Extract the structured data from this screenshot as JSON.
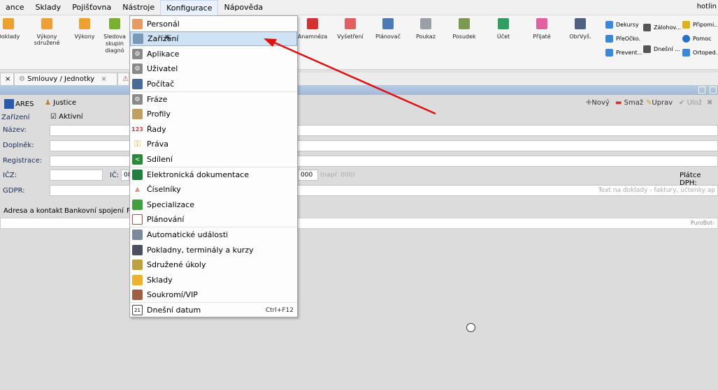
{
  "menubar": {
    "items": [
      "ance",
      "Sklady",
      "Pojišťovna",
      "Nástroje",
      "Konfigurace",
      "Nápověda"
    ],
    "hotline": "hotlin"
  },
  "ribbon": {
    "left": [
      {
        "label": "Doklady",
        "color": "#f0a030"
      },
      {
        "label": "Výkony\nsdružené",
        "color": "#f0a030"
      },
      {
        "label": "Výkony",
        "color": "#f0a030"
      },
      {
        "label": "Sledova\nskupin\ndiagnó",
        "color": "#78b030"
      }
    ],
    "right": [
      {
        "label": "Anamnéza",
        "color": "#d83030"
      },
      {
        "label": "Vyšetření",
        "color": "#e06060"
      },
      {
        "label": "Plánovač",
        "color": "#4a7ab8"
      },
      {
        "label": "Poukaz",
        "color": "#9aa0a8"
      },
      {
        "label": "Posudek",
        "color": "#7a9a50"
      },
      {
        "label": "Účet",
        "color": "#30a060"
      },
      {
        "label": "Přijaté",
        "color": "#e060a0"
      },
      {
        "label": "ObrVyš.",
        "color": "#506080"
      }
    ],
    "small": [
      {
        "label": "Dekursy",
        "color": "#3a88d8"
      },
      {
        "label": "PřeOčko.",
        "color": "#3a88d8"
      },
      {
        "label": "Prevent...",
        "color": "#3a88d8"
      },
      {
        "label": "Zálohov...",
        "color": "#555"
      },
      {
        "label": "Dnešní ...",
        "color": "#555"
      },
      {
        "label": "Připomi...",
        "color": "#e0b020"
      },
      {
        "label": "Pomoc",
        "color": "#2a70c8"
      },
      {
        "label": "Ortoped.",
        "color": "#3a88d8"
      }
    ]
  },
  "tabs": {
    "tab1": "Smlouvy / Jednotky"
  },
  "form": {
    "ares": "ARES",
    "justice": "Justice",
    "zarizeni": "Zařízení",
    "aktivni": "Aktivní",
    "nazev": "Název:",
    "doplnek": "Doplněk:",
    "registrace": "Registrace:",
    "icz": "IČZ:",
    "ic": "IČ:",
    "ic_value": "08",
    "dic_value": "000",
    "dic_hint": "(např. 000)",
    "platce": "Plátce DPH:",
    "gdpr": "GDPR:",
    "gdpr_hint": "Text na doklady - faktury, účtenky ap",
    "toolbar": {
      "novy": "Nový",
      "smaz": "Smaž",
      "uprav": "Uprav",
      "uloz": "Ulož"
    },
    "subtab1": "Adresa a kontakt",
    "subtab2": "Bankovní spojení",
    "subtab3": "F",
    "purobot": "PuroBot-"
  },
  "dropdown": {
    "items": [
      {
        "label": "Personál",
        "icon": "person-icon",
        "color": "#e89a60"
      },
      {
        "label": "Zařízení",
        "icon": "device-icon",
        "color": "#7a98b8"
      },
      {
        "label": "Aplikace",
        "icon": "gear-icon",
        "color": "#8a8a8a"
      },
      {
        "label": "Uživatel",
        "icon": "gear-icon",
        "color": "#8a8a8a"
      },
      {
        "label": "Počítač",
        "icon": "computer-icon",
        "color": "#4a6a9a"
      },
      {
        "label": "Fráze",
        "icon": "gear-icon",
        "color": "#8a8a8a"
      },
      {
        "label": "Profily",
        "icon": "profile-icon",
        "color": "#c0a060"
      },
      {
        "label": "Řady",
        "icon": "numbers-icon",
        "color": "#d04040"
      },
      {
        "label": "Práva",
        "icon": "key-icon",
        "color": "#e0b020"
      },
      {
        "label": "Sdílení",
        "icon": "share-icon",
        "color": "#2a8a3a"
      },
      {
        "label": "Elektronická dokumentace",
        "icon": "document-icon",
        "color": "#208040"
      },
      {
        "label": "Číselníky",
        "icon": "codelist-icon",
        "color": "#d04030"
      },
      {
        "label": "Specializace",
        "icon": "puzzle-icon",
        "color": "#40a040"
      },
      {
        "label": "Plánování",
        "icon": "calendar-icon",
        "color": "#c04040"
      },
      {
        "label": "Automatické události",
        "icon": "event-icon",
        "color": "#7a8a9a"
      },
      {
        "label": "Pokladny, terminály a kurzy",
        "icon": "calculator-icon",
        "color": "#4a5060"
      },
      {
        "label": "Sdružené úkoly",
        "icon": "tasks-icon",
        "color": "#c0a040"
      },
      {
        "label": "Sklady",
        "icon": "folder-icon",
        "color": "#f0b030"
      },
      {
        "label": "Soukromí/VIP",
        "icon": "vip-icon",
        "color": "#a06040"
      },
      {
        "label": "Dnešní datum",
        "icon": "calendar-21-icon",
        "color": "#404040",
        "shortcut": "Ctrl+F12"
      }
    ]
  }
}
